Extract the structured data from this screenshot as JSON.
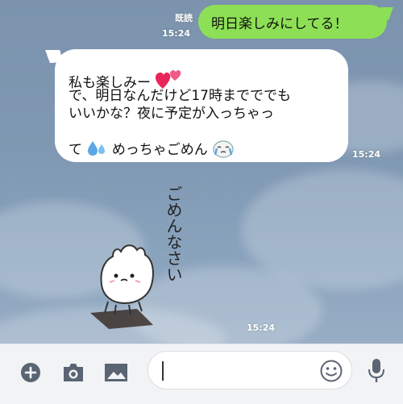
{
  "chat": {
    "outgoing": {
      "text": "明日楽しみにしてる！",
      "read_label": "既読",
      "time": "15:24"
    },
    "incoming": {
      "lines": [
        "私も楽しみー",
        "で、明日なんだけど17時までででも",
        "いいかな？夜に予定が入っちゃっ",
        "て",
        "めっちゃごめん"
      ],
      "time": "15:24"
    },
    "sticker": {
      "text": "ごめんなさい",
      "time": "15:24"
    }
  },
  "input_bar": {
    "icons": [
      "plus-icon",
      "camera-icon",
      "image-icon",
      "emoji-icon",
      "microphone-icon"
    ],
    "message_value": "",
    "message_placeholder": ""
  },
  "colors": {
    "outgoing_bubble": "#8de055",
    "incoming_bubble": "#ffffff",
    "chat_background": "#7f98b3",
    "heart": "#e8265a",
    "sweat": "#5aa8e6"
  }
}
